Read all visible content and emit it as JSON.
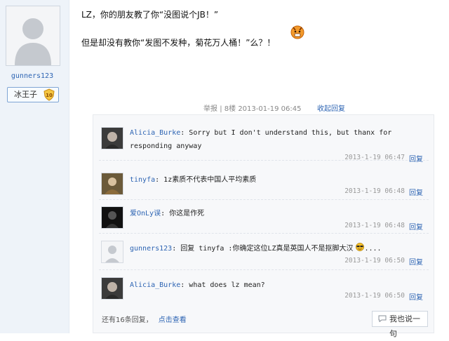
{
  "author": {
    "username": "gunners123",
    "badge_label": "冰王子",
    "badge_level": "10"
  },
  "post": {
    "line1": "LZ，你的朋友教了你“没图说个JB！”",
    "line2": "但是却没有教你“发图不发种，菊花万人桶！”么？！"
  },
  "post_meta": {
    "report": "举报",
    "floor": "8楼",
    "time": "2013-01-19 06:45",
    "fold": "收起回复"
  },
  "replies": [
    {
      "name": "Alicia_Burke",
      "sep": ":",
      "text": " Sorry but I don't understand this, but thanx for responding anyway",
      "time": "2013-1-19 06:47",
      "reply": "回复"
    },
    {
      "name": "tinyfa",
      "sep": ":",
      "text": " 1z素质不代表中国人平均素质",
      "time": "2013-1-19 06:48",
      "reply": "回复"
    },
    {
      "name": "爱OnLy误",
      "sep": ":",
      "text": " 你这是作死",
      "time": "2013-1-19 06:48",
      "reply": "回复"
    },
    {
      "name": "gunners123",
      "sep": ":",
      "text": " 回复 tinyfa :你确定这位LZ真是英国人不是抠脚大汉",
      "suffix": "....",
      "time": "2013-1-19 06:50",
      "reply": "回复"
    },
    {
      "name": "Alicia_Burke",
      "sep": ":",
      "text": " what does lz mean?",
      "time": "2013-1-19 06:50",
      "reply": "回复"
    }
  ],
  "footer": {
    "more_text": "还有16条回复，",
    "view_link": "点击查看",
    "say_button": "我也说一句"
  },
  "colors": {
    "link": "#2d64b3",
    "sidebar_bg": "#eef3f9",
    "reply_bg": "#f7f8fa"
  }
}
